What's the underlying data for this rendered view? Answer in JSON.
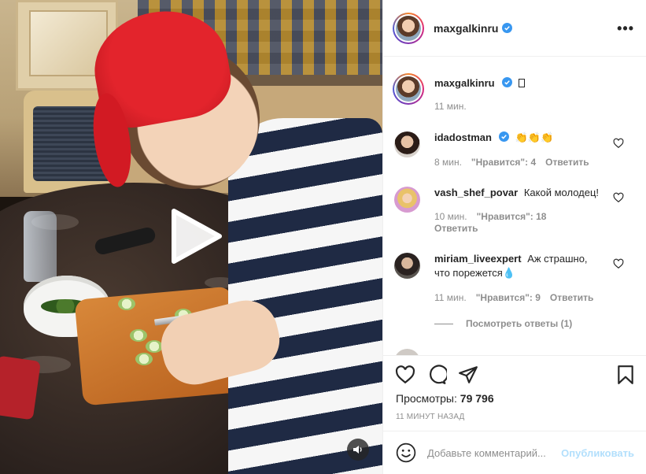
{
  "post": {
    "author": "maxgalkinru",
    "caption_emoji": "",
    "caption_time": "11 мин."
  },
  "header": {
    "username": "maxgalkinru",
    "more_icon": "more-horizontal-icon",
    "more_label": "•••"
  },
  "comments": [
    {
      "username": "idadostman",
      "verified": true,
      "text": "👏👏👏",
      "time": "8 мин.",
      "likes": "\"Нравится\": 4",
      "reply": "Ответить"
    },
    {
      "username": "vash_shef_povar",
      "verified": false,
      "text": "Какой молодец!",
      "time": "10 мин.",
      "likes": "\"Нравится\": 18",
      "reply": "Ответить"
    },
    {
      "username": "miriam_liveexpert",
      "verified": false,
      "text": "Аж страшно, что порежется💧",
      "time": "11 мин.",
      "likes": "\"Нравится\": 9",
      "reply": "Ответить"
    }
  ],
  "view_replies": "Посмотреть ответы (1)",
  "stats": {
    "views_label": "Просмотры:",
    "views_value": "79 796",
    "time_ago": "11 МИНУТ НАЗАД"
  },
  "add_comment": {
    "placeholder": "Добавьте комментарий...",
    "post_label": "Опубликовать"
  },
  "icons": {
    "play": "play-icon",
    "sound": "speaker-icon",
    "like": "heart-icon",
    "comment": "comment-icon",
    "share": "send-icon",
    "save": "bookmark-icon",
    "emoji": "emoji-icon",
    "verified": "verified-badge-icon"
  },
  "colors": {
    "accent": "#0095f6",
    "post_button_disabled": "#b2dffc",
    "muted_text": "#8e8e8e"
  }
}
